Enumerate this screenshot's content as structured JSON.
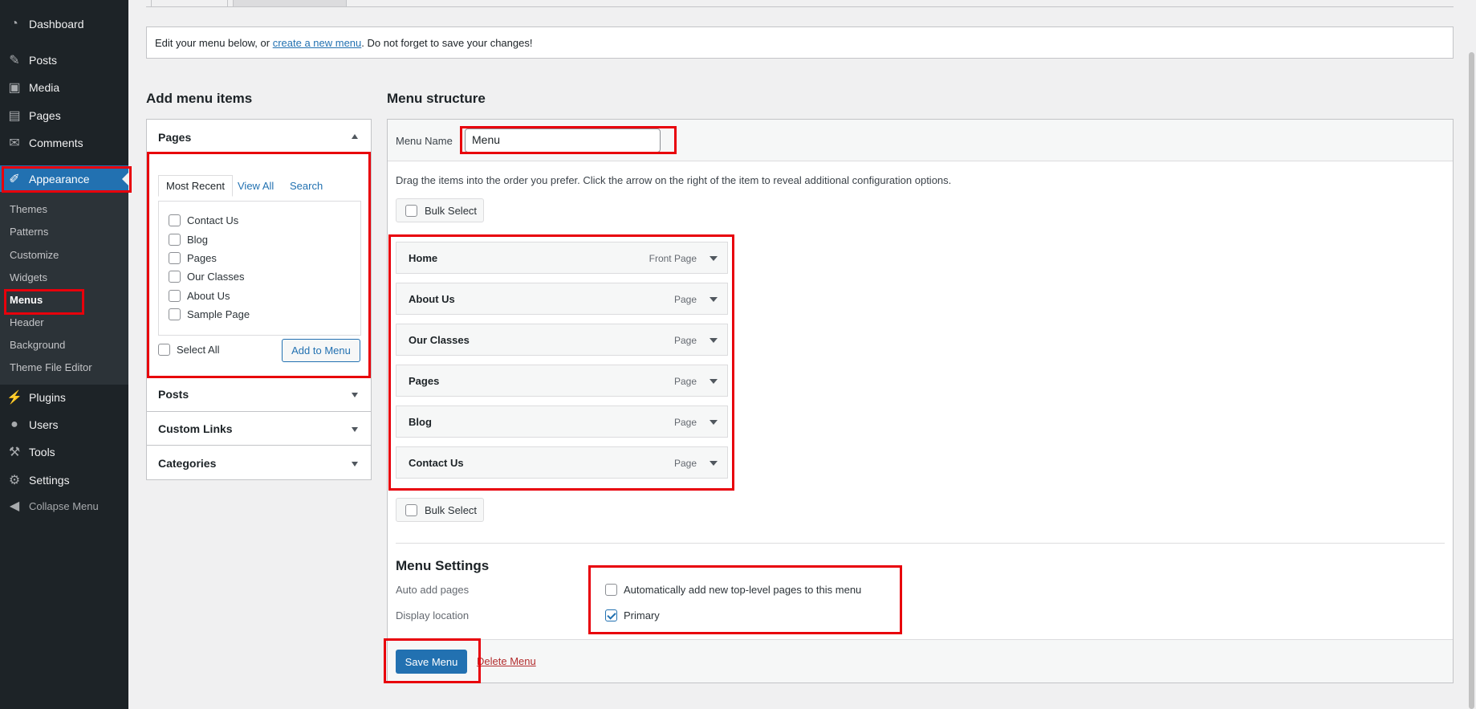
{
  "sidebar": {
    "items": [
      {
        "icon": "dashboard-icon",
        "glyph": "◔",
        "label": "Dashboard"
      },
      {
        "icon": "pushpin-icon",
        "glyph": "✎",
        "label": "Posts"
      },
      {
        "icon": "media-icon",
        "glyph": "▣",
        "label": "Media"
      },
      {
        "icon": "pages-icon",
        "glyph": "▤",
        "label": "Pages"
      },
      {
        "icon": "comments-icon",
        "glyph": "✉",
        "label": "Comments"
      },
      {
        "icon": "paintbrush-icon",
        "glyph": "✐",
        "label": "Appearance"
      },
      {
        "icon": "plugins-icon",
        "glyph": "⚡",
        "label": "Plugins"
      },
      {
        "icon": "users-icon",
        "glyph": "●",
        "label": "Users"
      },
      {
        "icon": "tools-icon",
        "glyph": "⚒",
        "label": "Tools"
      },
      {
        "icon": "settings-icon",
        "glyph": "⚙",
        "label": "Settings"
      }
    ],
    "submenu": [
      "Themes",
      "Patterns",
      "Customize",
      "Widgets",
      "Menus",
      "Header",
      "Background",
      "Theme File Editor"
    ],
    "collapse": {
      "glyph": "◀",
      "label": "Collapse Menu"
    }
  },
  "notice": {
    "before": "Edit your menu below, or ",
    "link": "create a new menu",
    "after": ". Do not forget to save your changes!"
  },
  "add_items": {
    "heading": "Add menu items",
    "pages_title": "Pages",
    "tabs": [
      "Most Recent",
      "View All",
      "Search"
    ],
    "pages": [
      "Contact Us",
      "Blog",
      "Pages",
      "Our Classes",
      "About Us",
      "Sample Page"
    ],
    "select_all": "Select All",
    "add_button": "Add to Menu",
    "other_sections": [
      "Posts",
      "Custom Links",
      "Categories"
    ]
  },
  "structure": {
    "heading": "Menu structure",
    "name_label": "Menu Name",
    "name_value": "Menu",
    "instructions": "Drag the items into the order you prefer. Click the arrow on the right of the item to reveal additional configuration options.",
    "bulk_select": "Bulk Select",
    "items": [
      {
        "title": "Home",
        "type": "Front Page"
      },
      {
        "title": "About Us",
        "type": "Page"
      },
      {
        "title": "Our Classes",
        "type": "Page"
      },
      {
        "title": "Pages",
        "type": "Page"
      },
      {
        "title": "Blog",
        "type": "Page"
      },
      {
        "title": "Contact Us",
        "type": "Page"
      }
    ]
  },
  "settings": {
    "heading": "Menu Settings",
    "auto_add_label": "Auto add pages",
    "auto_add_text": "Automatically add new top-level pages to this menu",
    "auto_add_checked": false,
    "display_label": "Display location",
    "location_text": "Primary",
    "location_checked": true
  },
  "footer": {
    "save": "Save Menu",
    "delete": "Delete Menu"
  },
  "colors": {
    "accent": "#2271b1",
    "sidebar": "#1d2327",
    "highlight": "#e8000b",
    "danger": "#b32d2e"
  }
}
